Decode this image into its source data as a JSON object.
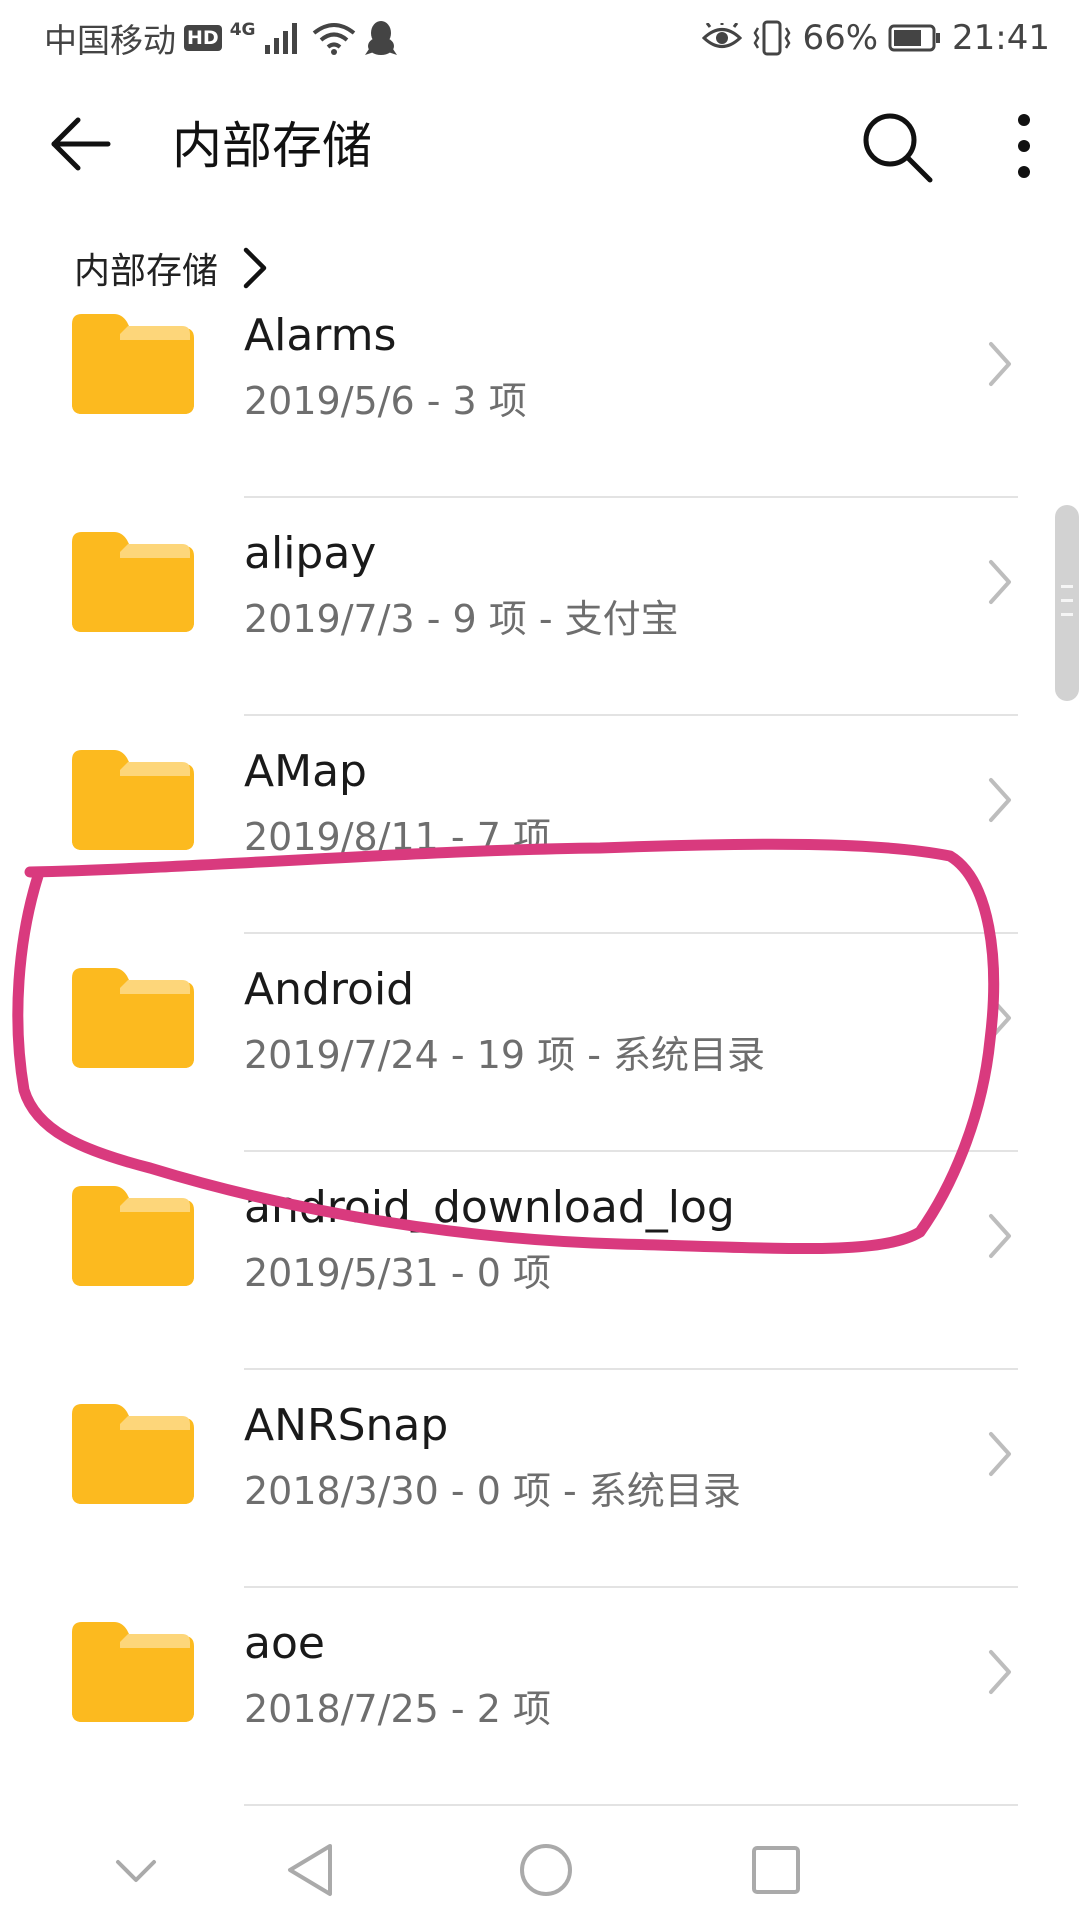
{
  "status_bar": {
    "carrier": "中国移动",
    "hd": "HD",
    "network": "4G",
    "battery": "66%",
    "time": "21:41",
    "icons": [
      "signal-icon",
      "wifi-icon",
      "qq-icon",
      "eye-icon",
      "vibrate-icon",
      "battery-icon"
    ]
  },
  "app_bar": {
    "title": "内部存储",
    "back_icon": "back-arrow-icon",
    "search_icon": "search-icon",
    "more_icon": "more-vertical-icon"
  },
  "breadcrumb": {
    "label": "内部存储"
  },
  "files": [
    {
      "name": "Alarms",
      "meta": "2019/5/6 - 3 项"
    },
    {
      "name": "alipay",
      "meta": "2019/7/3 - 9 项 - 支付宝"
    },
    {
      "name": "AMap",
      "meta": "2019/8/11 - 7 项"
    },
    {
      "name": "Android",
      "meta": "2019/7/24 - 19 项 - 系统目录"
    },
    {
      "name": "android_download_log",
      "meta": "2019/5/31 - 0 项"
    },
    {
      "name": "ANRSnap",
      "meta": "2018/3/30 - 0 项 - 系统目录"
    },
    {
      "name": "aoe",
      "meta": "2018/7/25 - 2 项"
    }
  ],
  "colors": {
    "folder": "#FCBA1F",
    "folder_tab": "#FDD67A",
    "annotation": "#D93A7E"
  },
  "nav_bar": {
    "icons": [
      "hide-nav-icon",
      "back-triangle-icon",
      "home-circle-icon",
      "recents-square-icon"
    ]
  }
}
